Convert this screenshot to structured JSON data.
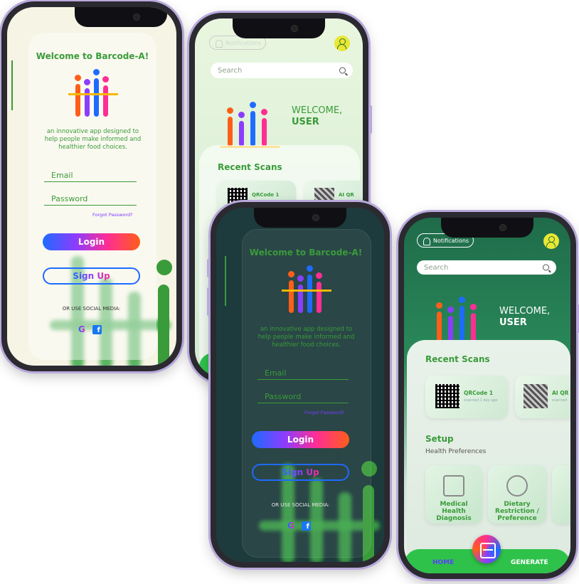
{
  "login_light": {
    "title": "Welcome to Barcode-A!",
    "tagline": "an innovative app  designed to help people make informed and healthier food choices.",
    "email_placeholder": "Email",
    "password_placeholder": "Password",
    "forgot": "Forgot Password?",
    "login": "Login",
    "signup": "Sign Up",
    "social": "OR USE SOCIAL MEDIA:",
    "google": "G",
    "facebook": "f"
  },
  "home_light": {
    "notifications": "Notifications",
    "search_placeholder": "Search",
    "welcome": "WELCOME,",
    "user": "USER",
    "recent_scans": "Recent Scans",
    "scans": [
      {
        "name": "QRCode 1"
      },
      {
        "name": "AI QR"
      }
    ]
  },
  "login_dark": {
    "title": "Welcome to Barcode-A!",
    "tagline": "an innovative app  designed to help people make informed and healthier food choices.",
    "email_placeholder": "Email",
    "password_placeholder": "Password",
    "forgot": "Forgot Password?",
    "login": "Login",
    "signup": "Sign Up",
    "social": "OR USE SOCIAL MEDIA:",
    "google": "G",
    "facebook": "f"
  },
  "home_dark": {
    "notifications": "Notifications",
    "search_placeholder": "Search",
    "welcome": "WELCOME,",
    "user": "USER",
    "recent_scans": "Recent Scans",
    "scans": [
      {
        "name": "QRCode 1",
        "sub": "scanned 1 day ago"
      },
      {
        "name": "AI QR",
        "sub": "scanned"
      }
    ],
    "setup": "Setup",
    "health_prefs": "Health Preferences",
    "prefs": [
      {
        "label": "Medical Health Diagnosis"
      },
      {
        "label": "Dietary Restriction / Preference"
      }
    ],
    "tab_home": "HOME",
    "tab_generate": "GENERATE"
  },
  "colors": {
    "brand_green": "#3a9b3a",
    "accent_yellow": "#f5b700",
    "bar_orange": "#ff5e1a",
    "bar_purple": "#8b3dff",
    "bar_blue": "#1e6bff",
    "bar_pink": "#ff2e93"
  }
}
